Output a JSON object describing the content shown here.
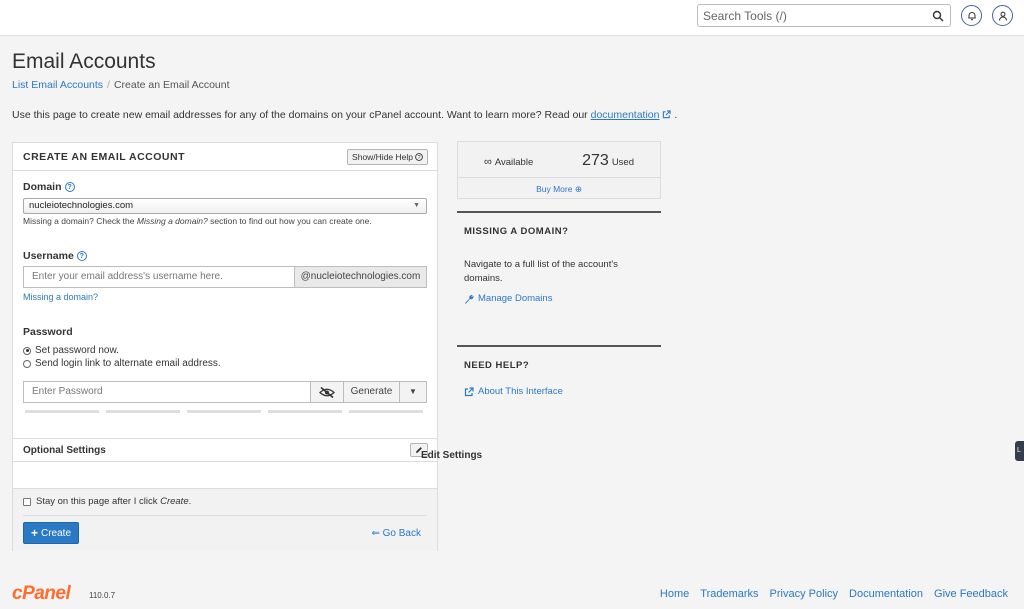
{
  "header": {
    "search_placeholder": "Search Tools (/)"
  },
  "page": {
    "title": "Email Accounts",
    "breadcrumb": [
      "List Email Accounts",
      "Create an Email Account"
    ],
    "intro_text": "Use this page to create new email addresses for any of the domains on your cPanel account. Want to learn more? Read our",
    "intro_link": "documentation",
    "intro_end": "."
  },
  "form": {
    "title": "CREATE AN EMAIL ACCOUNT",
    "show_hide_help": "Show/Hide Help",
    "domain_label": "Domain",
    "domain_value": "nucleiotechnologies.com",
    "domain_help_pre": "Missing a domain? Check the",
    "domain_help_em": "Missing a domain?",
    "domain_help_post": "section to find out how you can create one.",
    "username_label": "Username",
    "username_placeholder": "Enter your email address's username here.",
    "username_suffix": "@nucleiotechnologies.com",
    "missing_domain_link": "Missing a domain?",
    "password_label": "Password",
    "radio_set_now": "Set password now.",
    "radio_send_link": "Send login link to alternate email address.",
    "password_placeholder": "Enter Password",
    "generate_label": "Generate",
    "optional_settings": "Optional Settings",
    "edit_settings": "Edit Settings",
    "stay_pre": "Stay on this page after I click",
    "stay_em": "Create",
    "stay_post": ".",
    "create_label": "Create",
    "go_back_label": "Go Back"
  },
  "stats": {
    "available_symbol": "∞",
    "available_label": "Available",
    "used_value": "273",
    "used_label": "Used",
    "buy_more": "Buy More"
  },
  "sidebar": {
    "missing_title": "MISSING A DOMAIN?",
    "missing_text": "Navigate to a full list of the account's domains.",
    "manage_domains": "Manage Domains",
    "help_title": "NEED HELP?",
    "about_interface": "About This Interface"
  },
  "footer": {
    "logo": "cPanel",
    "version": "110.0.7",
    "links": [
      "Home",
      "Trademarks",
      "Privacy Policy",
      "Documentation",
      "Give Feedback"
    ]
  },
  "colors": {
    "accent": "#2a79c4",
    "brand": "#ff6c2c"
  }
}
